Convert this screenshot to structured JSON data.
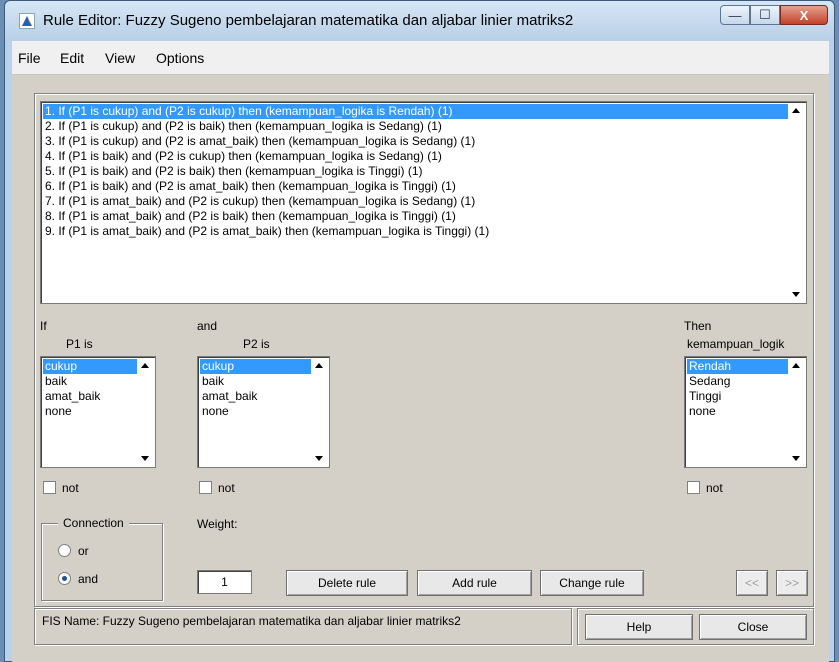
{
  "window": {
    "title": "Rule Editor: Fuzzy Sugeno pembelajaran matematika dan aljabar linier matriks2",
    "controls": {
      "minimize": "—",
      "maximize": "☐",
      "close": "X"
    }
  },
  "menu": [
    "File",
    "Edit",
    "View",
    "Options"
  ],
  "rules": [
    "1. If (P1 is cukup) and (P2 is cukup) then (kemampuan_logika is Rendah) (1)",
    "2. If (P1 is cukup) and (P2 is baik) then (kemampuan_logika is Sedang) (1)",
    "3. If (P1 is cukup) and (P2 is amat_baik) then (kemampuan_logika is Sedang) (1)",
    "4. If (P1 is baik) and (P2 is cukup) then (kemampuan_logika is Sedang) (1)",
    "5. If (P1 is baik) and (P2 is baik) then (kemampuan_logika is Tinggi) (1)",
    "6. If (P1 is baik) and (P2 is amat_baik) then (kemampuan_logika is Tinggi) (1)",
    "7. If (P1 is amat_baik) and (P2 is cukup) then (kemampuan_logika is Sedang) (1)",
    "8. If (P1 is amat_baik) and (P2 is baik) then (kemampuan_logika is Tinggi) (1)",
    "9. If (P1 is amat_baik) and (P2 is amat_baik) then (kemampuan_logika is Tinggi) (1)"
  ],
  "selected_rule": 0,
  "if_label": "If",
  "and_label": "and",
  "then_label": "Then",
  "p1": {
    "label": "P1 is",
    "options": [
      "cukup",
      "baik",
      "amat_baik",
      "none"
    ],
    "selected": 0,
    "not_label": "not"
  },
  "p2": {
    "label": "P2 is",
    "options": [
      "cukup",
      "baik",
      "amat_baik",
      "none"
    ],
    "selected": 0,
    "not_label": "not"
  },
  "out": {
    "label": "kemampuan_logik",
    "options": [
      "Rendah",
      "Sedang",
      "Tinggi",
      "none"
    ],
    "selected": 0,
    "not_label": "not"
  },
  "connection": {
    "title": "Connection",
    "or_label": "or",
    "and_label": "and",
    "selected": "and"
  },
  "weight": {
    "label": "Weight:",
    "value": "1"
  },
  "buttons": {
    "delete": "Delete rule",
    "add": "Add rule",
    "change": "Change rule",
    "prev": "<<",
    "next": ">>",
    "help": "Help",
    "close": "Close"
  },
  "status": "FIS Name: Fuzzy Sugeno pembelajaran matematika dan aljabar linier matriks2",
  "colors": {
    "selection": "#3399ff",
    "panel": "#d4d0c8"
  }
}
